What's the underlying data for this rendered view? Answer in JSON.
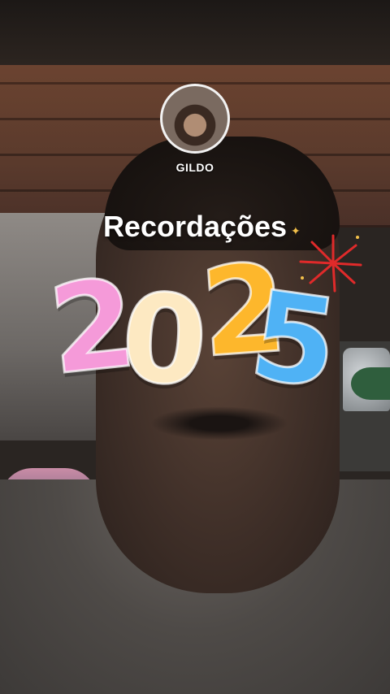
{
  "story": {
    "username": "GILDO",
    "title": "Recordações",
    "year_digits": [
      "2",
      "0",
      "2",
      "5"
    ],
    "sparkle_glyph": "✦"
  },
  "colors": {
    "digit_1": "#f59ad9",
    "digit_2": "#fde9c2",
    "digit_3": "#fdb72c",
    "digit_4": "#4fb2f5",
    "firework": "#e02a2a"
  }
}
